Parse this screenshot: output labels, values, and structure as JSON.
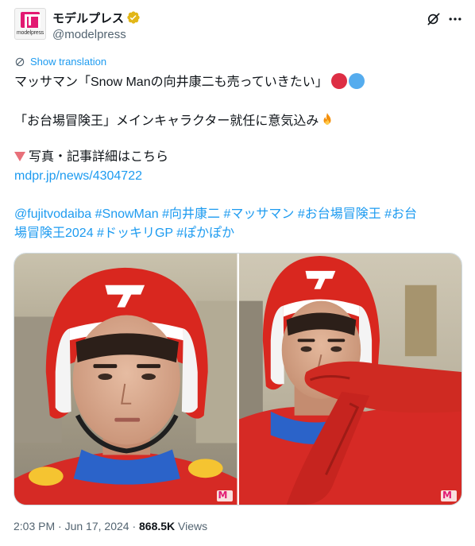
{
  "account": {
    "display_name": "モデルプレス",
    "handle": "@modelpress",
    "avatar_text": "modelpress",
    "verified_color": "#e2b719"
  },
  "translate": {
    "label": "Show translation"
  },
  "post": {
    "line1": "マッサマン「Snow Manの向井康二も売っていきたい」",
    "line2": "「お台場冒険王」メインキャラクター就任に意気込み",
    "line3": "写真・記事詳細はこちら",
    "link": "mdpr.jp/news/4304722",
    "hashtags_line1": "@fujitvodaiba #SnowMan #向井康二 #マッサマン #お台場冒険王 #お台",
    "hashtags_line2": "場冒険王2024 #ドッキリGP #ぽかぽか"
  },
  "meta": {
    "time": "2:03 PM",
    "sep1": " · ",
    "date": "Jun 17, 2024",
    "sep2": " · ",
    "views_count": "868.5K",
    "views_label": " Views"
  },
  "colors": {
    "accent": "#1d9bf0",
    "brand": "#e21a72",
    "text": "#0f1419",
    "muted": "#536471"
  },
  "icons": [
    "verified-badge-icon",
    "grok-icon",
    "more-icon",
    "translate-icon",
    "red-circle-icon",
    "blue-circle-icon",
    "fire-icon",
    "red-triangle-icon",
    "modelpress-watermark-icon"
  ]
}
